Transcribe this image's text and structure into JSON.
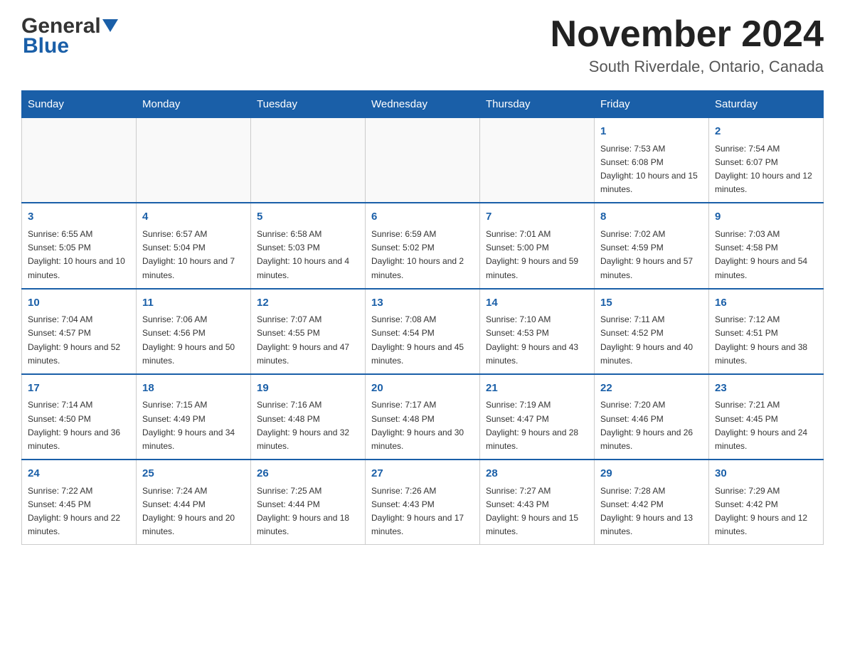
{
  "header": {
    "logo_general": "General",
    "logo_blue": "Blue",
    "title": "November 2024",
    "subtitle": "South Riverdale, Ontario, Canada"
  },
  "calendar": {
    "days_of_week": [
      "Sunday",
      "Monday",
      "Tuesday",
      "Wednesday",
      "Thursday",
      "Friday",
      "Saturday"
    ],
    "weeks": [
      [
        {
          "day": "",
          "sunrise": "",
          "sunset": "",
          "daylight": ""
        },
        {
          "day": "",
          "sunrise": "",
          "sunset": "",
          "daylight": ""
        },
        {
          "day": "",
          "sunrise": "",
          "sunset": "",
          "daylight": ""
        },
        {
          "day": "",
          "sunrise": "",
          "sunset": "",
          "daylight": ""
        },
        {
          "day": "",
          "sunrise": "",
          "sunset": "",
          "daylight": ""
        },
        {
          "day": "1",
          "sunrise": "Sunrise: 7:53 AM",
          "sunset": "Sunset: 6:08 PM",
          "daylight": "Daylight: 10 hours and 15 minutes."
        },
        {
          "day": "2",
          "sunrise": "Sunrise: 7:54 AM",
          "sunset": "Sunset: 6:07 PM",
          "daylight": "Daylight: 10 hours and 12 minutes."
        }
      ],
      [
        {
          "day": "3",
          "sunrise": "Sunrise: 6:55 AM",
          "sunset": "Sunset: 5:05 PM",
          "daylight": "Daylight: 10 hours and 10 minutes."
        },
        {
          "day": "4",
          "sunrise": "Sunrise: 6:57 AM",
          "sunset": "Sunset: 5:04 PM",
          "daylight": "Daylight: 10 hours and 7 minutes."
        },
        {
          "day": "5",
          "sunrise": "Sunrise: 6:58 AM",
          "sunset": "Sunset: 5:03 PM",
          "daylight": "Daylight: 10 hours and 4 minutes."
        },
        {
          "day": "6",
          "sunrise": "Sunrise: 6:59 AM",
          "sunset": "Sunset: 5:02 PM",
          "daylight": "Daylight: 10 hours and 2 minutes."
        },
        {
          "day": "7",
          "sunrise": "Sunrise: 7:01 AM",
          "sunset": "Sunset: 5:00 PM",
          "daylight": "Daylight: 9 hours and 59 minutes."
        },
        {
          "day": "8",
          "sunrise": "Sunrise: 7:02 AM",
          "sunset": "Sunset: 4:59 PM",
          "daylight": "Daylight: 9 hours and 57 minutes."
        },
        {
          "day": "9",
          "sunrise": "Sunrise: 7:03 AM",
          "sunset": "Sunset: 4:58 PM",
          "daylight": "Daylight: 9 hours and 54 minutes."
        }
      ],
      [
        {
          "day": "10",
          "sunrise": "Sunrise: 7:04 AM",
          "sunset": "Sunset: 4:57 PM",
          "daylight": "Daylight: 9 hours and 52 minutes."
        },
        {
          "day": "11",
          "sunrise": "Sunrise: 7:06 AM",
          "sunset": "Sunset: 4:56 PM",
          "daylight": "Daylight: 9 hours and 50 minutes."
        },
        {
          "day": "12",
          "sunrise": "Sunrise: 7:07 AM",
          "sunset": "Sunset: 4:55 PM",
          "daylight": "Daylight: 9 hours and 47 minutes."
        },
        {
          "day": "13",
          "sunrise": "Sunrise: 7:08 AM",
          "sunset": "Sunset: 4:54 PM",
          "daylight": "Daylight: 9 hours and 45 minutes."
        },
        {
          "day": "14",
          "sunrise": "Sunrise: 7:10 AM",
          "sunset": "Sunset: 4:53 PM",
          "daylight": "Daylight: 9 hours and 43 minutes."
        },
        {
          "day": "15",
          "sunrise": "Sunrise: 7:11 AM",
          "sunset": "Sunset: 4:52 PM",
          "daylight": "Daylight: 9 hours and 40 minutes."
        },
        {
          "day": "16",
          "sunrise": "Sunrise: 7:12 AM",
          "sunset": "Sunset: 4:51 PM",
          "daylight": "Daylight: 9 hours and 38 minutes."
        }
      ],
      [
        {
          "day": "17",
          "sunrise": "Sunrise: 7:14 AM",
          "sunset": "Sunset: 4:50 PM",
          "daylight": "Daylight: 9 hours and 36 minutes."
        },
        {
          "day": "18",
          "sunrise": "Sunrise: 7:15 AM",
          "sunset": "Sunset: 4:49 PM",
          "daylight": "Daylight: 9 hours and 34 minutes."
        },
        {
          "day": "19",
          "sunrise": "Sunrise: 7:16 AM",
          "sunset": "Sunset: 4:48 PM",
          "daylight": "Daylight: 9 hours and 32 minutes."
        },
        {
          "day": "20",
          "sunrise": "Sunrise: 7:17 AM",
          "sunset": "Sunset: 4:48 PM",
          "daylight": "Daylight: 9 hours and 30 minutes."
        },
        {
          "day": "21",
          "sunrise": "Sunrise: 7:19 AM",
          "sunset": "Sunset: 4:47 PM",
          "daylight": "Daylight: 9 hours and 28 minutes."
        },
        {
          "day": "22",
          "sunrise": "Sunrise: 7:20 AM",
          "sunset": "Sunset: 4:46 PM",
          "daylight": "Daylight: 9 hours and 26 minutes."
        },
        {
          "day": "23",
          "sunrise": "Sunrise: 7:21 AM",
          "sunset": "Sunset: 4:45 PM",
          "daylight": "Daylight: 9 hours and 24 minutes."
        }
      ],
      [
        {
          "day": "24",
          "sunrise": "Sunrise: 7:22 AM",
          "sunset": "Sunset: 4:45 PM",
          "daylight": "Daylight: 9 hours and 22 minutes."
        },
        {
          "day": "25",
          "sunrise": "Sunrise: 7:24 AM",
          "sunset": "Sunset: 4:44 PM",
          "daylight": "Daylight: 9 hours and 20 minutes."
        },
        {
          "day": "26",
          "sunrise": "Sunrise: 7:25 AM",
          "sunset": "Sunset: 4:44 PM",
          "daylight": "Daylight: 9 hours and 18 minutes."
        },
        {
          "day": "27",
          "sunrise": "Sunrise: 7:26 AM",
          "sunset": "Sunset: 4:43 PM",
          "daylight": "Daylight: 9 hours and 17 minutes."
        },
        {
          "day": "28",
          "sunrise": "Sunrise: 7:27 AM",
          "sunset": "Sunset: 4:43 PM",
          "daylight": "Daylight: 9 hours and 15 minutes."
        },
        {
          "day": "29",
          "sunrise": "Sunrise: 7:28 AM",
          "sunset": "Sunset: 4:42 PM",
          "daylight": "Daylight: 9 hours and 13 minutes."
        },
        {
          "day": "30",
          "sunrise": "Sunrise: 7:29 AM",
          "sunset": "Sunset: 4:42 PM",
          "daylight": "Daylight: 9 hours and 12 minutes."
        }
      ]
    ]
  }
}
